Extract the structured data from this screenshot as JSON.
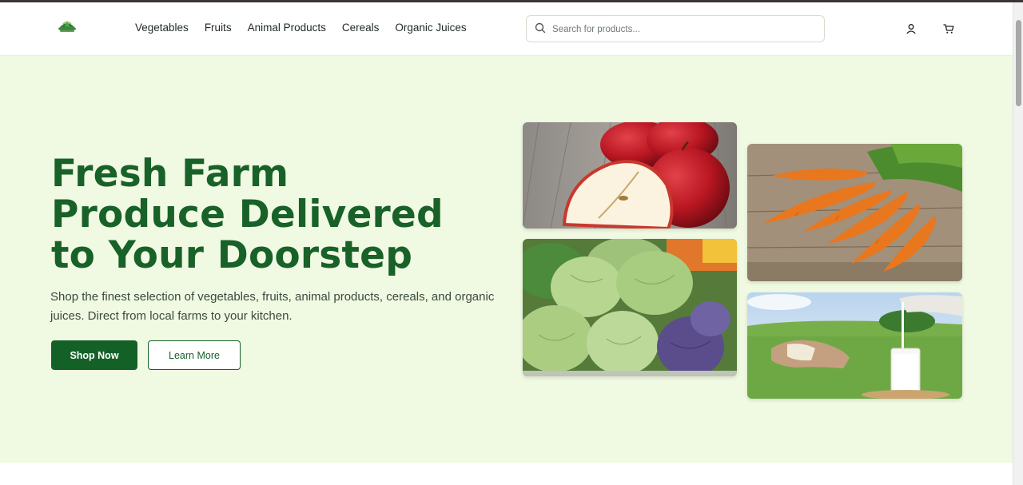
{
  "header": {
    "nav": [
      "Vegetables",
      "Fruits",
      "Animal Products",
      "Cereals",
      "Organic Juices"
    ],
    "search_placeholder": "Search for products...",
    "icons": {
      "logo": "farm-logo",
      "search": "search-icon",
      "account": "user-icon",
      "cart": "cart-icon"
    }
  },
  "hero": {
    "title": "Fresh Farm Produce Delivered to Your Doorstep",
    "subtitle": "Shop the finest selection of vegetables, fruits, animal products, cereals, and organic juices. Direct from local farms to your kitchen.",
    "primary_button": "Shop Now",
    "secondary_button": "Learn More",
    "images": [
      "apples",
      "carrots",
      "cabbage",
      "milk-and-cow"
    ]
  },
  "colors": {
    "brand_green": "#146128",
    "hero_background": "#f0f9e1",
    "text_dark": "#1f2a22"
  }
}
